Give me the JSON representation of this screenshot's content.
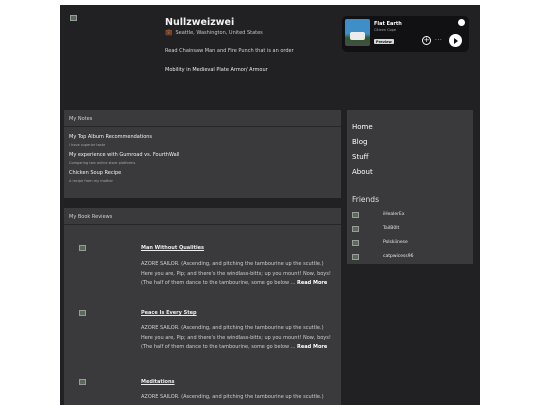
{
  "profile": {
    "name": "Nullzweizwei",
    "location_icon": "briefcase-icon",
    "location": "Seattle, Washington, United States",
    "bio_line1": "Read Chainsaw Man and Fire Punch that is an order",
    "bio_line2": "Mobility in Medieval Plate Armor/ Armour"
  },
  "player": {
    "track": "Flat Earth",
    "artist": "Citizen Cope",
    "badge": "Preview",
    "add_glyph": "+",
    "more_glyph": "···"
  },
  "notes": {
    "heading": "My Notes",
    "items": [
      {
        "title": "My Top Album Recommendations",
        "subtitle": "I have superior taste"
      },
      {
        "title": "My experience with Gumroad vs. FourthWall",
        "subtitle": "Comparing two online store platforms"
      },
      {
        "title": "Chicken Soup Recipe",
        "subtitle": "A recipe from my mother"
      }
    ]
  },
  "reviews": {
    "heading": "My Book Reviews",
    "items": [
      {
        "title": "Man Without Qualities",
        "text": "AZORE SAILOR. (Ascending, and pitching the tambourine up the scuttle.) Here you are, Pip; and there's the windlass-bitts; up you mount! Now, boys! (The half of them dance to the tambourine, some go below ...",
        "more": "Read More"
      },
      {
        "title": "Peace Is Every Step",
        "text": "AZORE SAILOR. (Ascending, and pitching the tambourine up the scuttle.) Here you are, Pip; and there's the windlass-bitts; up you mount! Now, boys! (The half of them dance to the tambourine, some go below ...",
        "more": "Read More"
      },
      {
        "title": "Meditations",
        "text": "AZORE SAILOR. (Ascending, and pitching the tambourine up the scuttle.)",
        "more": ""
      }
    ]
  },
  "nav": {
    "items": [
      "Home",
      "Blog",
      "Stuff",
      "About"
    ]
  },
  "friends": {
    "heading": "Friends",
    "items": [
      "iHealerEx",
      "TailB0lt",
      "Polskiinese",
      "catpwicess96"
    ]
  }
}
